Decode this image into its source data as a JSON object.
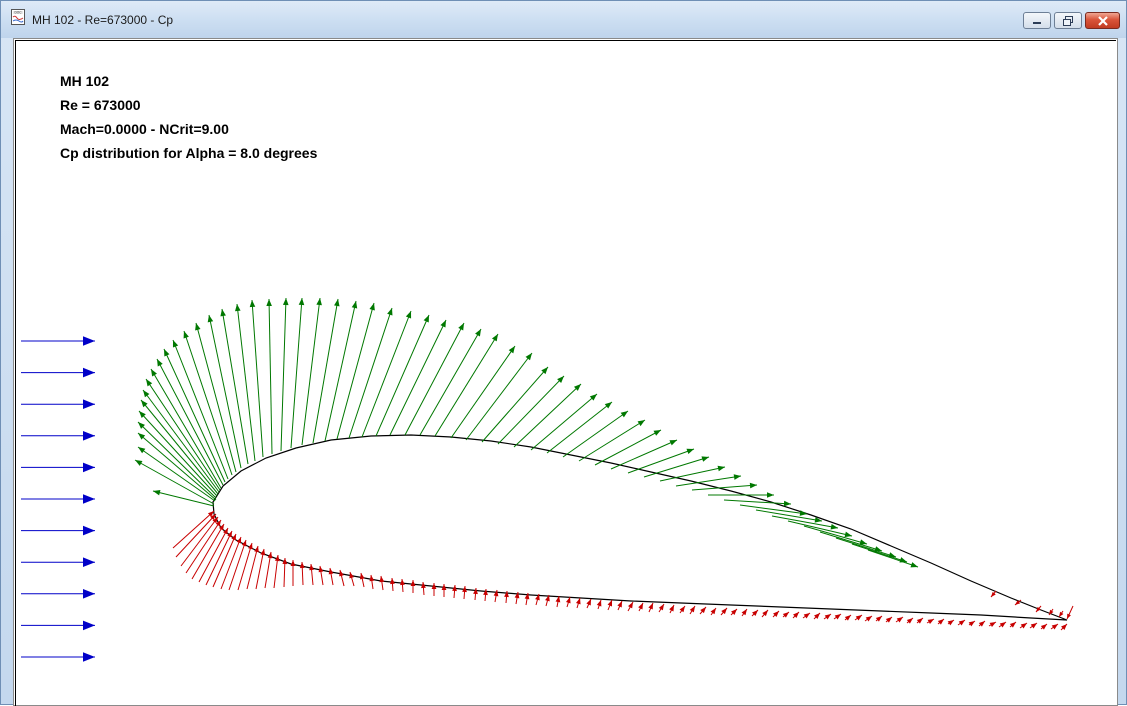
{
  "window": {
    "title": "MH 102 - Re=673000 - Cp",
    "app_icon": "document-icon",
    "controls": {
      "minimize": "minimize-icon",
      "maximize": "maximize-icon",
      "close": "close-icon"
    }
  },
  "info": {
    "line1": "MH 102",
    "line2": "Re = 673000",
    "line3": "Mach=0.0000 - NCrit=9.00",
    "line4": "Cp distribution for  Alpha = 8.0 degrees"
  },
  "colors": {
    "freestream": "#0000c8",
    "suction": "#007800",
    "pressure": "#c80000",
    "airfoil": "#000000"
  },
  "freestream_arrow_count": 11
}
